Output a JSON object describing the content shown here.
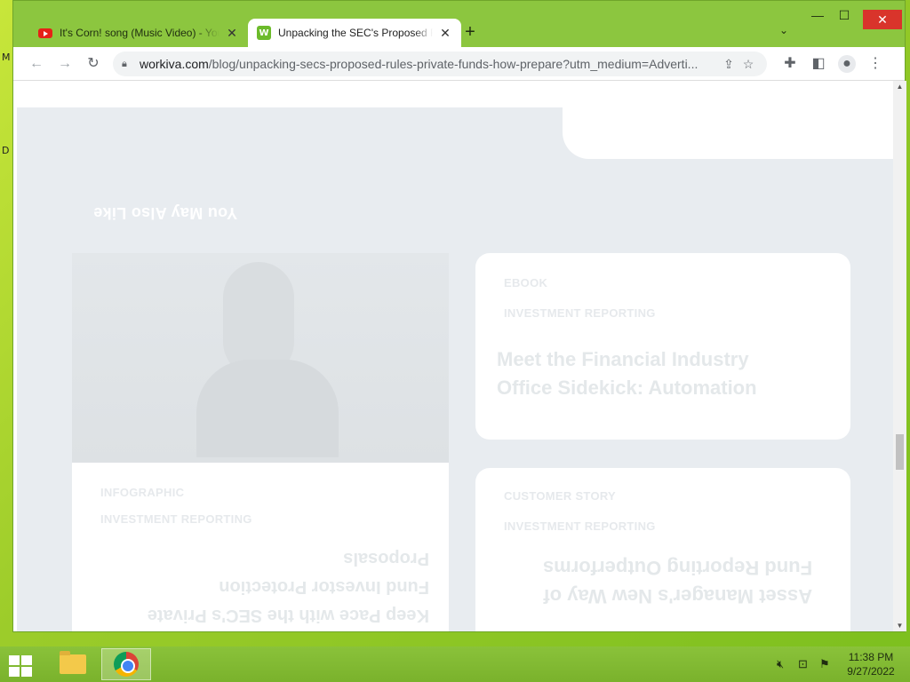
{
  "desktop": {
    "left_labels": [
      "M",
      "D"
    ]
  },
  "browser": {
    "tabs": [
      {
        "title": "It's Corn! song (Music Video) - YouTube",
        "icon": "youtube-icon",
        "active": false
      },
      {
        "title": "Unpacking the SEC's Proposed Rules",
        "icon": "workiva-icon",
        "active": true
      }
    ],
    "new_tab_label": "+",
    "window_controls": {
      "minimize": "—",
      "maximize": "☐",
      "close": "✕"
    },
    "url_domain": "workiva.com",
    "url_path": "/blog/unpacking-secs-proposed-rules-private-funds-how-prepare?utm_medium=Adverti..."
  },
  "page": {
    "section_heading": "You May Also Like",
    "cards": [
      {
        "type": "EBOOK",
        "category": "INVESTMENT REPORTING",
        "title_lines": [
          "Meet the Financial Industry",
          "Office Sidekick: Automation"
        ]
      },
      {
        "type": "INFOGRAPHIC",
        "category": "INVESTMENT REPORTING",
        "title_lines": [
          "Keep Pace with the SEC's Private",
          "Fund Investor Protection",
          "Proposals"
        ]
      },
      {
        "type": "CUSTOMER STORY",
        "category": "INVESTMENT REPORTING",
        "title_lines": [
          "Asset Manager's New Way of",
          "Fund Reporting Outperforms"
        ]
      }
    ]
  },
  "taskbar": {
    "clock_time": "11:38 PM",
    "clock_date": "9/27/2022"
  }
}
